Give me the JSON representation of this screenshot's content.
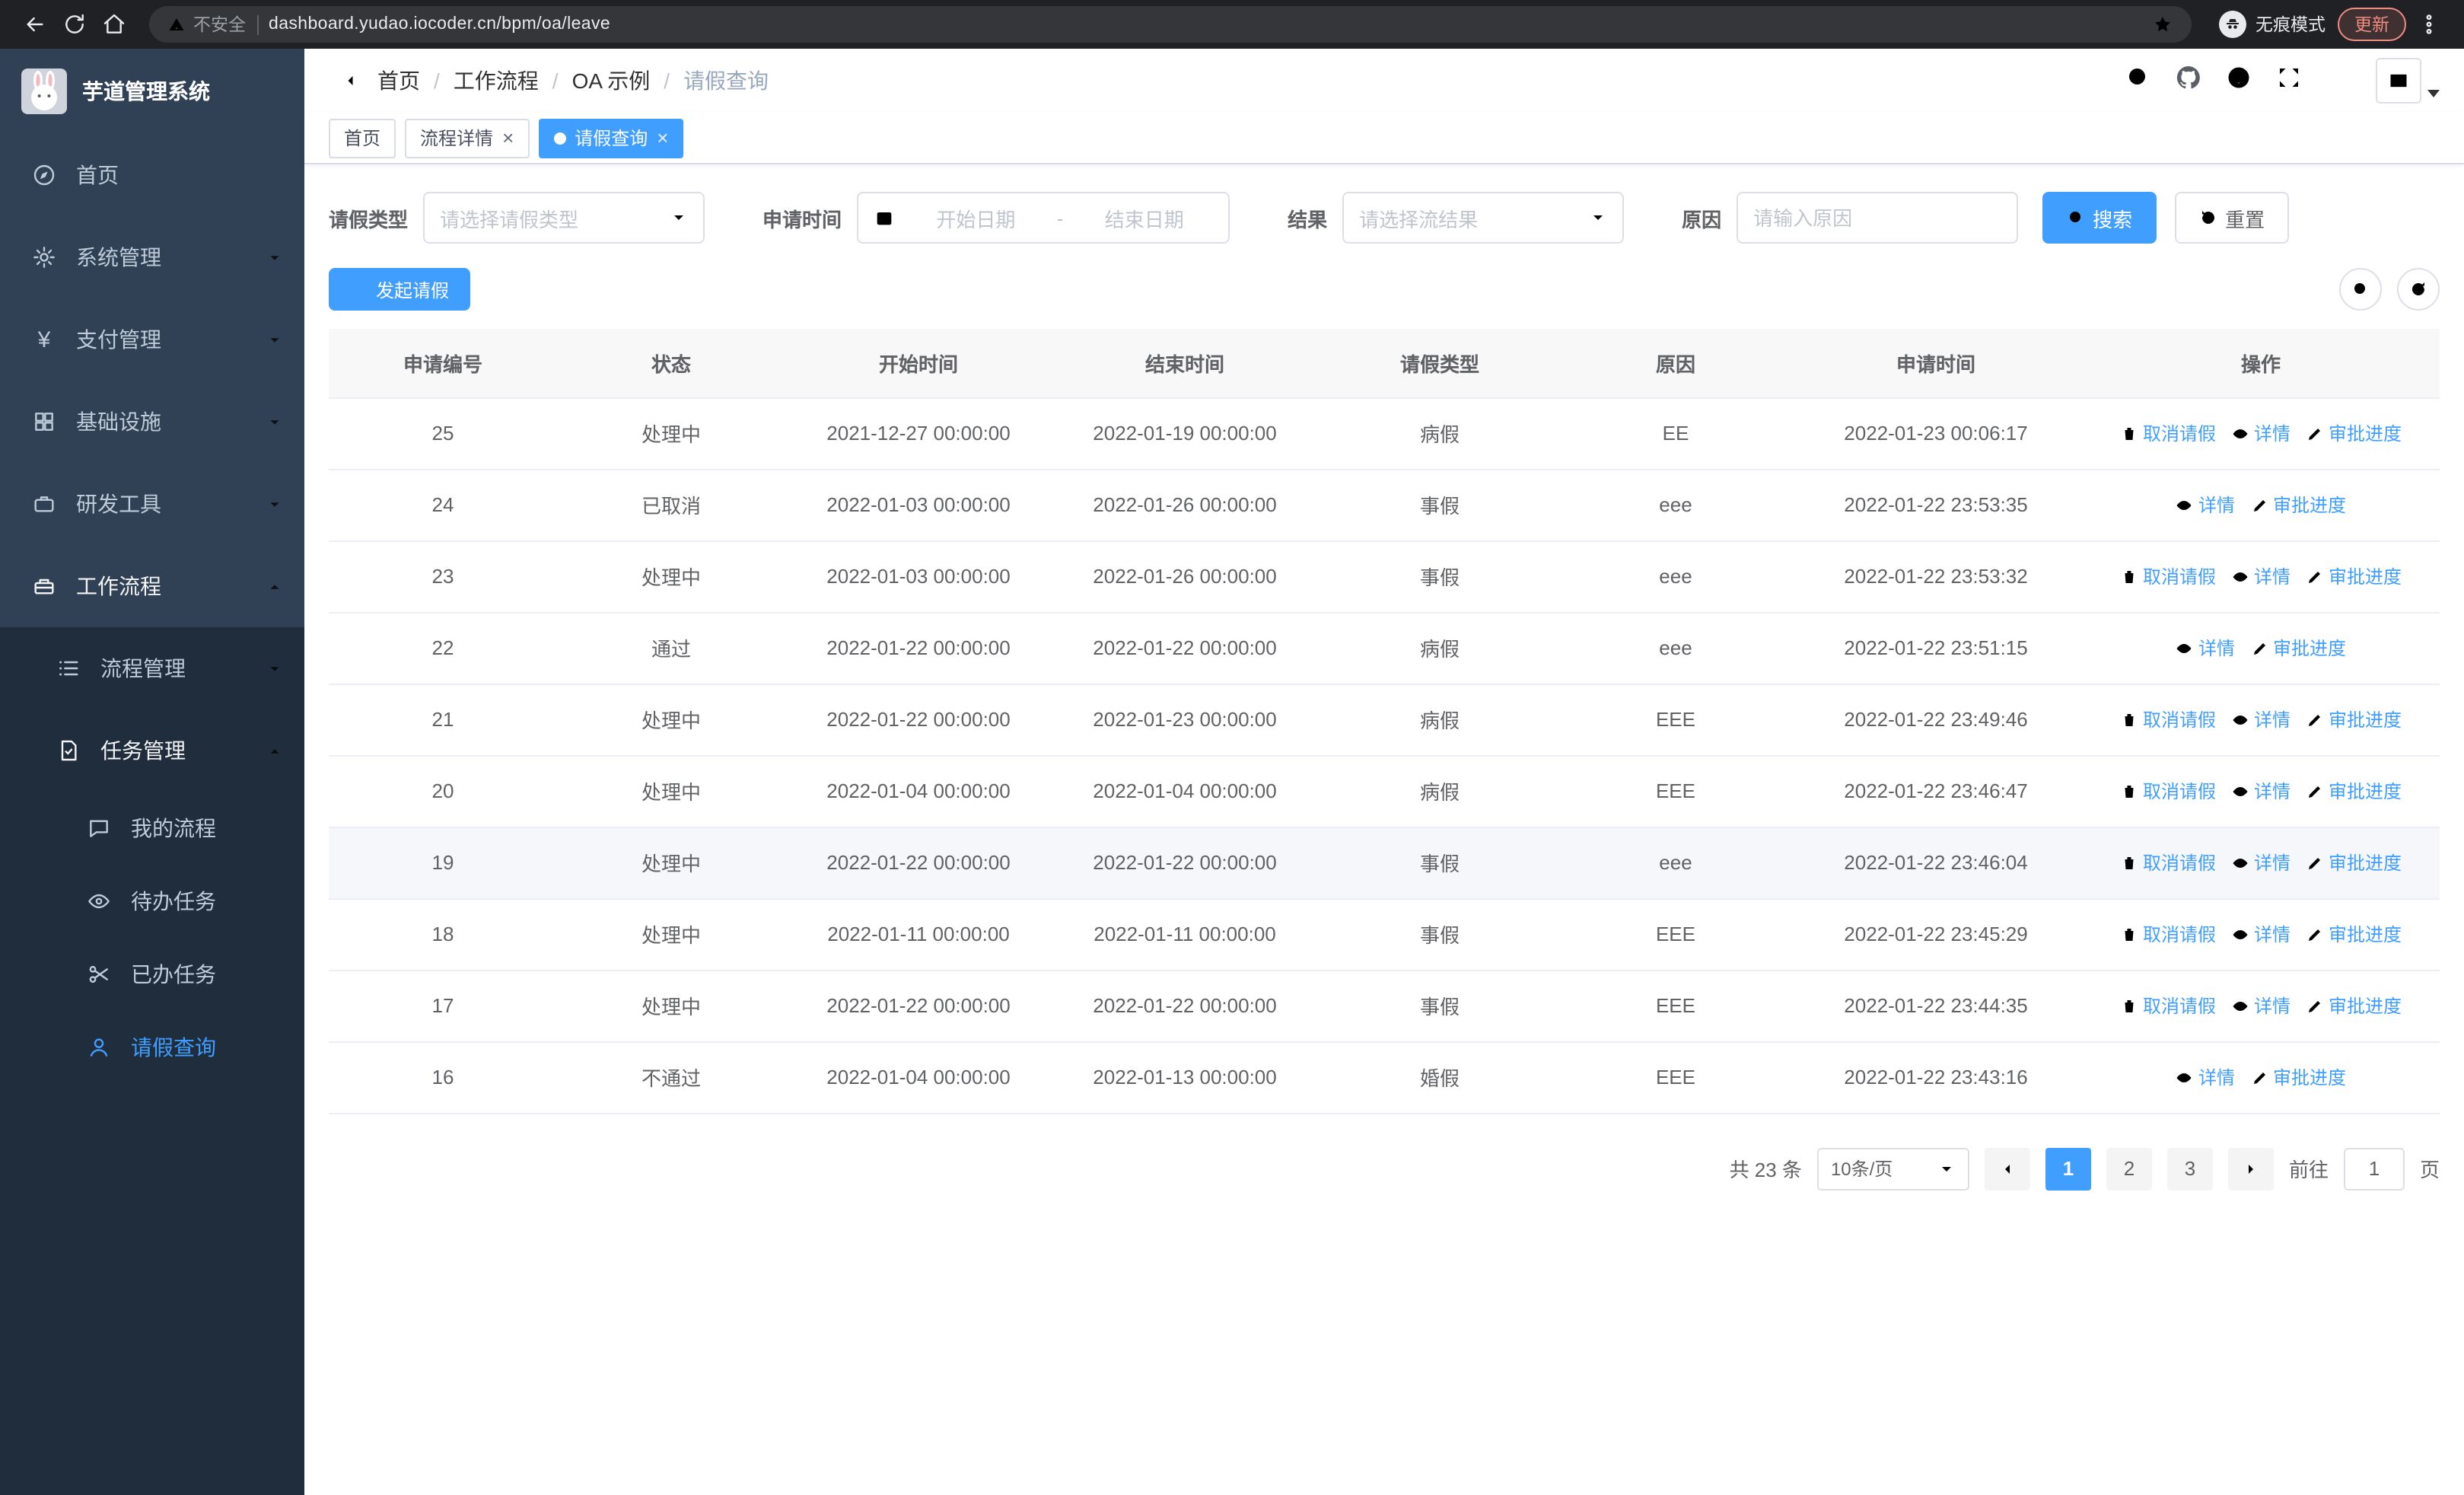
{
  "colors": {
    "primary": "#409eff",
    "sidebar_bg": "#304156",
    "submenu_bg": "#1f2d3d",
    "active_text": "#409eff",
    "table_header_bg": "#f8f8f9"
  },
  "icons": {
    "security": "warning-triangle",
    "bookmark": "star",
    "incognito": "incognito-badge",
    "header": [
      "search",
      "github",
      "help",
      "fullscreen",
      "font-size"
    ],
    "actions": {
      "cancel": "trash",
      "detail": "eye",
      "progress": "pen"
    },
    "create": "plus",
    "search_button": "magnifier",
    "reset_button": "refresh"
  },
  "browser": {
    "security_warning": "不安全",
    "url": "dashboard.yudao.iocoder.cn/bpm/oa/leave",
    "incognito_label": "无痕模式",
    "update_label": "更新"
  },
  "sidebar": {
    "logo_title": "芋道管理系统",
    "items": [
      {
        "label": "首页"
      },
      {
        "label": "系统管理"
      },
      {
        "label": "支付管理"
      },
      {
        "label": "基础设施"
      },
      {
        "label": "研发工具"
      },
      {
        "label": "工作流程"
      }
    ],
    "submenu": [
      {
        "label": "流程管理"
      },
      {
        "label": "任务管理"
      }
    ],
    "task_children": [
      {
        "label": "我的流程"
      },
      {
        "label": "待办任务"
      },
      {
        "label": "已办任务"
      },
      {
        "label": "请假查询"
      }
    ]
  },
  "header": {
    "breadcrumb": [
      "首页",
      "工作流程",
      "OA 示例",
      "请假查询"
    ]
  },
  "tabs": [
    {
      "label": "首页"
    },
    {
      "label": "流程详情"
    },
    {
      "label": "请假查询"
    }
  ],
  "filters": {
    "leave_type_label": "请假类型",
    "leave_type_placeholder": "请选择请假类型",
    "apply_time_label": "申请时间",
    "start_date_placeholder": "开始日期",
    "range_separator": "-",
    "end_date_placeholder": "结束日期",
    "result_label": "结果",
    "result_placeholder": "请选择流结果",
    "reason_label": "原因",
    "reason_placeholder": "请输入原因",
    "search_label": "搜索",
    "reset_label": "重置"
  },
  "toolbar": {
    "create_label": "发起请假"
  },
  "table": {
    "columns": [
      "申请编号",
      "状态",
      "开始时间",
      "结束时间",
      "请假类型",
      "原因",
      "申请时间",
      "操作"
    ],
    "actions": {
      "cancel": "取消请假",
      "detail": "详情",
      "progress": "审批进度"
    },
    "rows": [
      {
        "id": "25",
        "status": "处理中",
        "start": "2021-12-27 00:00:00",
        "end": "2022-01-19 00:00:00",
        "type": "病假",
        "reason": "EE",
        "applied": "2022-01-23 00:06:17",
        "cancellable": true,
        "highlighted": false
      },
      {
        "id": "24",
        "status": "已取消",
        "start": "2022-01-03 00:00:00",
        "end": "2022-01-26 00:00:00",
        "type": "事假",
        "reason": "eee",
        "applied": "2022-01-22 23:53:35",
        "cancellable": false,
        "highlighted": false
      },
      {
        "id": "23",
        "status": "处理中",
        "start": "2022-01-03 00:00:00",
        "end": "2022-01-26 00:00:00",
        "type": "事假",
        "reason": "eee",
        "applied": "2022-01-22 23:53:32",
        "cancellable": true,
        "highlighted": false
      },
      {
        "id": "22",
        "status": "通过",
        "start": "2022-01-22 00:00:00",
        "end": "2022-01-22 00:00:00",
        "type": "病假",
        "reason": "eee",
        "applied": "2022-01-22 23:51:15",
        "cancellable": false,
        "highlighted": false
      },
      {
        "id": "21",
        "status": "处理中",
        "start": "2022-01-22 00:00:00",
        "end": "2022-01-23 00:00:00",
        "type": "病假",
        "reason": "EEE",
        "applied": "2022-01-22 23:49:46",
        "cancellable": true,
        "highlighted": false
      },
      {
        "id": "20",
        "status": "处理中",
        "start": "2022-01-04 00:00:00",
        "end": "2022-01-04 00:00:00",
        "type": "病假",
        "reason": "EEE",
        "applied": "2022-01-22 23:46:47",
        "cancellable": true,
        "highlighted": false
      },
      {
        "id": "19",
        "status": "处理中",
        "start": "2022-01-22 00:00:00",
        "end": "2022-01-22 00:00:00",
        "type": "事假",
        "reason": "eee",
        "applied": "2022-01-22 23:46:04",
        "cancellable": true,
        "highlighted": true
      },
      {
        "id": "18",
        "status": "处理中",
        "start": "2022-01-11 00:00:00",
        "end": "2022-01-11 00:00:00",
        "type": "事假",
        "reason": "EEE",
        "applied": "2022-01-22 23:45:29",
        "cancellable": true,
        "highlighted": false
      },
      {
        "id": "17",
        "status": "处理中",
        "start": "2022-01-22 00:00:00",
        "end": "2022-01-22 00:00:00",
        "type": "事假",
        "reason": "EEE",
        "applied": "2022-01-22 23:44:35",
        "cancellable": true,
        "highlighted": false
      },
      {
        "id": "16",
        "status": "不通过",
        "start": "2022-01-04 00:00:00",
        "end": "2022-01-13 00:00:00",
        "type": "婚假",
        "reason": "EEE",
        "applied": "2022-01-22 23:43:16",
        "cancellable": false,
        "highlighted": false
      }
    ]
  },
  "pagination": {
    "total_label": "共 23 条",
    "page_size_label": "10条/页",
    "pages": [
      "1",
      "2",
      "3"
    ],
    "active_page": "1",
    "goto_label": "前往",
    "goto_value": "1",
    "page_unit": "页"
  }
}
